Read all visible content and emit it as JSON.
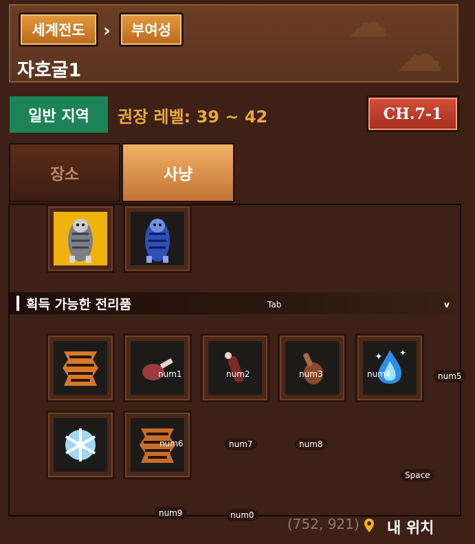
{
  "breadcrumb": {
    "world_map": "세계전도",
    "region": "부여성"
  },
  "zone_title": "자호굴1",
  "region_type": "일반 지역",
  "recommended_level": "권장 레벨: 39 ~ 42",
  "chapter": "CH.7-1",
  "tabs": {
    "place": "장소",
    "hunt": "사냥"
  },
  "monsters": [
    {
      "icon": "gray-tiger-icon",
      "selected": true
    },
    {
      "icon": "blue-tiger-icon",
      "selected": false
    }
  ],
  "loot_header": "획득 가능한 전리품",
  "loot_items": [
    {
      "icon": "tiger-pelt-icon",
      "key": ""
    },
    {
      "icon": "meat-leg-icon",
      "key": "num1"
    },
    {
      "icon": "bone-meat-icon",
      "key": "num2"
    },
    {
      "icon": "drumstick-icon",
      "key": "num3"
    },
    {
      "icon": "blue-flame-icon",
      "key": "num4"
    },
    {
      "icon": "snowflake-icon",
      "key": ""
    },
    {
      "icon": "tiger-pelt-icon",
      "key": "num6"
    }
  ],
  "key_hints": {
    "tab": "Tab",
    "v": "v",
    "num5": "num5",
    "num7": "num7",
    "num8": "num8",
    "space": "Space",
    "num9": "num9",
    "num0": "num0"
  },
  "location": {
    "coords": "(752, 921)",
    "label": "내 위치"
  },
  "colors": {
    "region_badge": "#1c8356",
    "chapter_badge": "#c23f2c",
    "level_text": "#e8a93a",
    "selected_slot": "#f0b30e"
  }
}
